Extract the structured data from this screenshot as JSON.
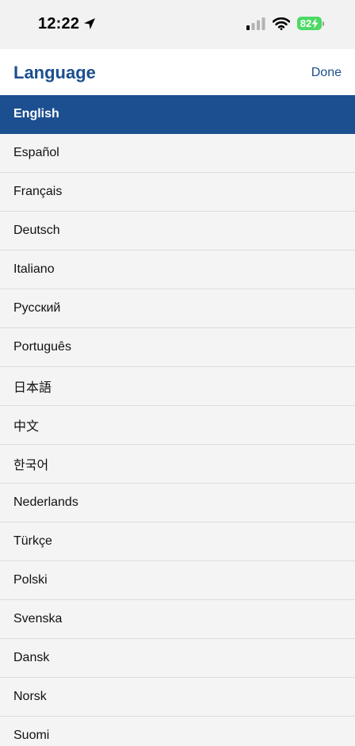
{
  "status_bar": {
    "time": "12:22",
    "battery_level": "82",
    "icons": [
      "location-arrow-icon",
      "cellular-signal-icon",
      "wifi-icon",
      "battery-charging-icon"
    ]
  },
  "header": {
    "title": "Language",
    "done_label": "Done"
  },
  "languages": {
    "selected_index": 0,
    "items": [
      {
        "label": "English"
      },
      {
        "label": "Español"
      },
      {
        "label": "Français"
      },
      {
        "label": "Deutsch"
      },
      {
        "label": "Italiano"
      },
      {
        "label": "Русский"
      },
      {
        "label": "Português"
      },
      {
        "label": "日本語"
      },
      {
        "label": "中文"
      },
      {
        "label": "한국어"
      },
      {
        "label": "Nederlands"
      },
      {
        "label": "Türkçe"
      },
      {
        "label": "Polski"
      },
      {
        "label": "Svenska"
      },
      {
        "label": "Dansk"
      },
      {
        "label": "Norsk"
      },
      {
        "label": "Suomi"
      }
    ]
  },
  "colors": {
    "accent": "#1b4f8f",
    "battery": "#4cd964",
    "list_background": "#f4f4f4",
    "separator": "#dcdcdc"
  }
}
